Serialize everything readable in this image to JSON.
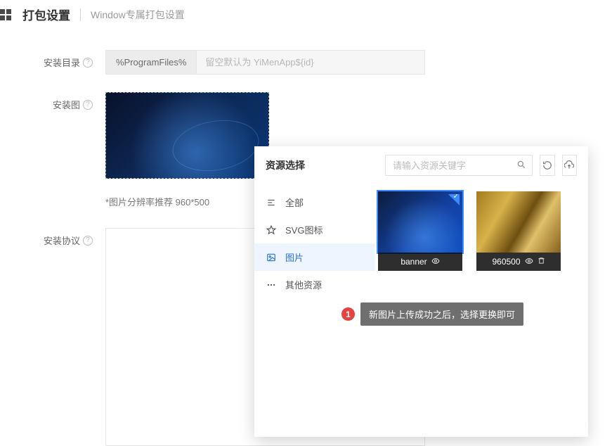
{
  "header": {
    "title": "打包设置",
    "subtitle": "Window专属打包设置"
  },
  "form": {
    "install_dir": {
      "label": "安装目录",
      "prefix": "%ProgramFiles%",
      "placeholder": "留空默认为 YiMenApp${id}",
      "value": ""
    },
    "install_image": {
      "label": "安装图",
      "hint": "*图片分辨率推荐 960*500"
    },
    "install_agreement": {
      "label": "安装协议"
    }
  },
  "popover": {
    "title": "资源选择",
    "search_placeholder": "请输入资源关键字",
    "categories": [
      {
        "key": "all",
        "label": "全部"
      },
      {
        "key": "svg",
        "label": "SVG图标"
      },
      {
        "key": "image",
        "label": "图片"
      },
      {
        "key": "other",
        "label": "其他资源"
      }
    ],
    "active_category": "image",
    "items": [
      {
        "name": "banner",
        "selected": true,
        "kind": "banner"
      },
      {
        "name": "960500",
        "selected": false,
        "kind": "gold"
      }
    ]
  },
  "annotation": {
    "num": "1",
    "text": "新图片上传成功之后，选择更换即可"
  }
}
